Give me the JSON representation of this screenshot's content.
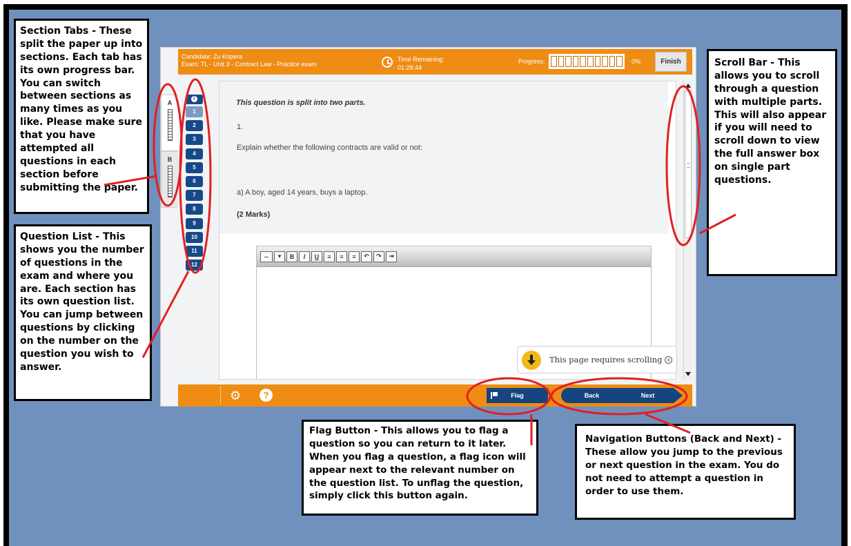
{
  "callouts": {
    "section_tabs": "Section Tabs - These split the paper up into sections. Each tab has its own progress bar. You can switch between sections as many times as you like. Please make sure that you have attempted all questions in each section before submitting the paper.",
    "question_list": "Question List - This shows you the number of questions in the exam and where you are. Each section has its own question list. You can jump between questions by clicking on the number on the question you wish to answer.",
    "scroll_bar": "Scroll Bar - This allows you to scroll through a question with multiple parts. This will also appear if you will need to scroll down to view the full answer box on single part questions.",
    "flag_button": "Flag Button - This allows you to flag a question so you can return to it later. When you flag a question, a flag icon will appear next to the relevant number on the question list. To unflag the question, simply click this button again.",
    "navigation": "Navigation Buttons (Back and Next) - These allow you jump to the previous or next question in the exam. You do not need to attempt a question in order to use them."
  },
  "header": {
    "candidate": "Candidate: Zu Kopera",
    "exam": "Exam: TL - Unit 3 - Contract Law - Practice exam",
    "time_label": "Time Remaining:",
    "time_value": "01:28:44",
    "progress_label": "Progress:",
    "progress_percent": "0%",
    "progress_fraction": 0,
    "finish_label": "Finish"
  },
  "sections": [
    {
      "label": "A"
    },
    {
      "label": "B"
    }
  ],
  "questions": [
    "1",
    "2",
    "3",
    "4",
    "5",
    "6",
    "7",
    "8",
    "9",
    "10",
    "11",
    "12"
  ],
  "current_question": "1",
  "question": {
    "intro": "This question is split into two parts.",
    "number": "1.",
    "instruction": "Explain whether the following contracts are valid or not:",
    "part": "a) A boy, aged 14 years, buys a laptop.",
    "marks": "(2 Marks)"
  },
  "editor": {
    "format_select": "--",
    "buttons": [
      "B",
      "I",
      "U",
      "≡",
      "≡",
      "≡",
      "↶",
      "↷",
      "⇥"
    ]
  },
  "notice": {
    "text": "This page requires scrolling",
    "close": "×"
  },
  "footer": {
    "flag_label": "Flag",
    "back_label": "Back",
    "next_label": "Next",
    "help_glyph": "?",
    "settings_glyph": "⚙"
  },
  "colors": {
    "background": "#7090bd",
    "accent_orange": "#ef8c14",
    "nav_blue": "#15447e",
    "annotation_red": "#e02020"
  }
}
